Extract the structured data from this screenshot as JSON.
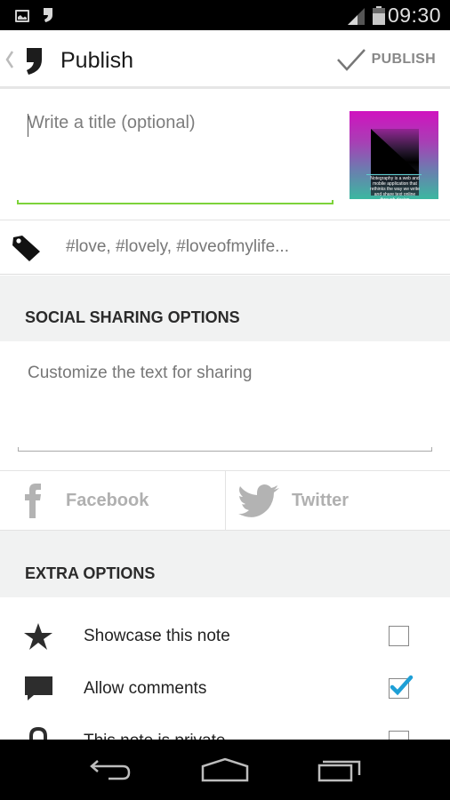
{
  "status_bar": {
    "time": "09:30",
    "icons": [
      "gallery-notification-icon",
      "app-notification-icon",
      "signal-icon",
      "battery-icon"
    ]
  },
  "action_bar": {
    "title": "Publish",
    "publish_label": "PUBLISH",
    "icons": [
      "back-chevron-icon",
      "app-logo-icon",
      "checkmark-icon"
    ]
  },
  "title_field": {
    "placeholder": "Write a title (optional)",
    "value": "",
    "accent_color": "#7dd33a"
  },
  "thumbnail": {
    "caption": "Notegraphy is a web and mobile application that rethinks the way we write and share text online through design"
  },
  "tags": {
    "placeholder": "#love, #lovely, #loveofmylife...",
    "icon": "tag-icon"
  },
  "social_section": {
    "title": "SOCIAL SHARING OPTIONS",
    "share_text_placeholder": "Customize the text for sharing",
    "buttons": [
      {
        "label": "Facebook",
        "icon": "facebook-icon"
      },
      {
        "label": "Twitter",
        "icon": "twitter-icon"
      }
    ]
  },
  "extra_section": {
    "title": "EXTRA OPTIONS",
    "options": [
      {
        "label": "Showcase this note",
        "icon": "star-icon",
        "checked": false
      },
      {
        "label": "Allow comments",
        "icon": "comment-icon",
        "checked": true
      },
      {
        "label": "This note is private",
        "icon": "lock-icon",
        "checked": false
      }
    ],
    "check_color": "#1e9fd6"
  },
  "nav_bar": {
    "buttons": [
      "back",
      "home",
      "recent-apps"
    ]
  }
}
